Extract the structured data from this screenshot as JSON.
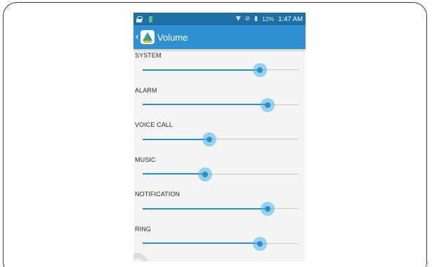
{
  "status_bar": {
    "battery_percent": "12%",
    "time": "1:47 AM"
  },
  "app_bar": {
    "title": "Volume",
    "icon": "app-logo-icon"
  },
  "sliders": [
    {
      "label": "SYSTEM",
      "level": 0.75
    },
    {
      "label": "ALARM",
      "level": 0.8
    },
    {
      "label": "VOICE CALL",
      "level": 0.43
    },
    {
      "label": "MUSIC",
      "level": 0.4
    },
    {
      "label": "NOTIFICATION",
      "level": 0.8
    },
    {
      "label": "RING",
      "level": 0.75
    }
  ],
  "colors": {
    "status_bar": "#1f6fa5",
    "app_bar": "#2f8fd0",
    "slider_accent": "#2a8fc9"
  },
  "slide_mark": "2"
}
